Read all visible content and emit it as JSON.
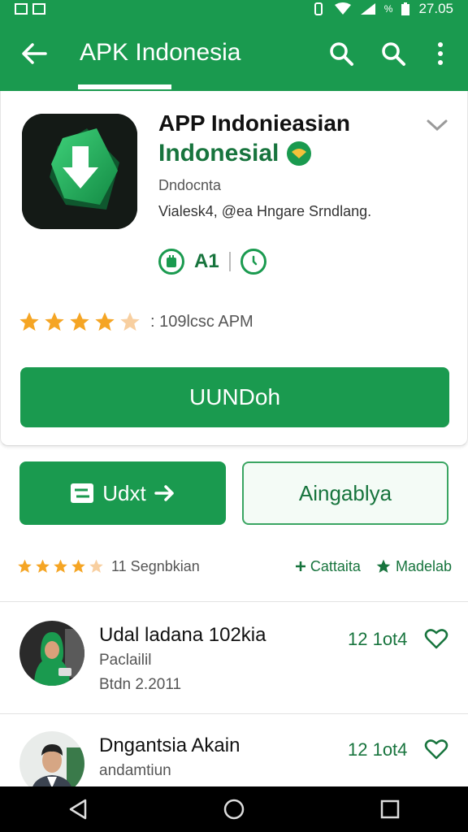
{
  "status_bar": {
    "time": "27.05",
    "percent_glyph": "%"
  },
  "app_bar": {
    "title": "APK Indonesia",
    "back_icon": "arrow-left-icon",
    "search_icon": "search-icon",
    "search_alt_icon": "search-icon",
    "menu_icon": "more-vertical-icon"
  },
  "app": {
    "name": "APP Indonieasian",
    "subtitle": "Indonesial",
    "developer": "Dndocnta",
    "description": "Vialesk4, @ea Hngare Srndlang.",
    "meta_label": "A1",
    "rating_stars": 4.5,
    "rating_text": ": 109lcsc APM",
    "install_label": "UUNDoh"
  },
  "actions": {
    "update_label": "Udxt",
    "open_label": "Aingablya"
  },
  "stats": {
    "rating_stars": 4.5,
    "reviews_text": "11 Segnbkian",
    "link1": "Cattaita",
    "link2": "Madelab"
  },
  "reviews": [
    {
      "title": "Udal ladana 102kia",
      "line1": "Paclailil",
      "line2": "Btdn 2.2011",
      "count": "12 1ot4"
    },
    {
      "title": "Dngantsia Akain",
      "line1": "andamtiun",
      "line2": "",
      "count": "12 1ot4"
    }
  ],
  "colors": {
    "primary": "#1a9a4f",
    "primary_dark": "#17743d",
    "star": "#f5a524"
  }
}
